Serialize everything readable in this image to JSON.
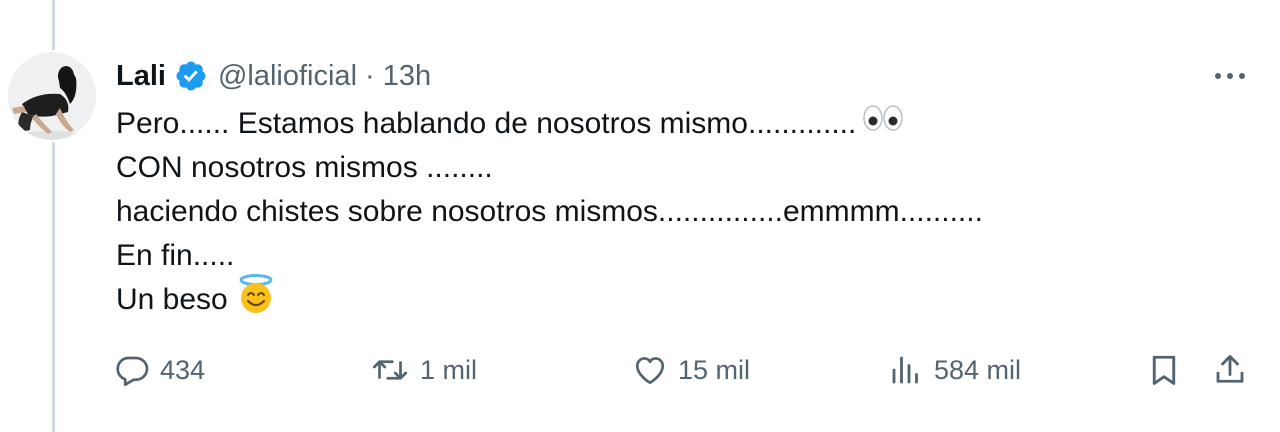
{
  "tweet": {
    "author": {
      "name": "Lali",
      "handle": "@lalioficial",
      "separator": "·",
      "time": "13h",
      "verified_color": "#1d9bf0"
    },
    "lines": [
      {
        "text": "Pero...... Estamos hablando de nosotros mismo.............",
        "emoji": "eyes-emoji"
      },
      {
        "text": "CON nosotros mismos ........"
      },
      {
        "text": "haciendo chistes sobre nosotros mismos...............emmmm.........."
      },
      {
        "text": "En fin....."
      },
      {
        "text": "Un beso",
        "emoji": "smiling-face-with-halo-emoji"
      }
    ],
    "metrics": {
      "replies": "434",
      "retweets": "1 mil",
      "likes": "15 mil",
      "views": "584 mil"
    },
    "icons": {
      "reply": "reply-icon",
      "retweet": "retweet-icon",
      "like": "heart-icon",
      "views": "views-icon",
      "bookmark": "bookmark-icon",
      "share": "share-icon",
      "more": "more-icon"
    },
    "colors": {
      "text": "#0f1419",
      "secondary": "#536471",
      "thread_line": "#cfd9de",
      "accent": "#1d9bf0"
    }
  }
}
